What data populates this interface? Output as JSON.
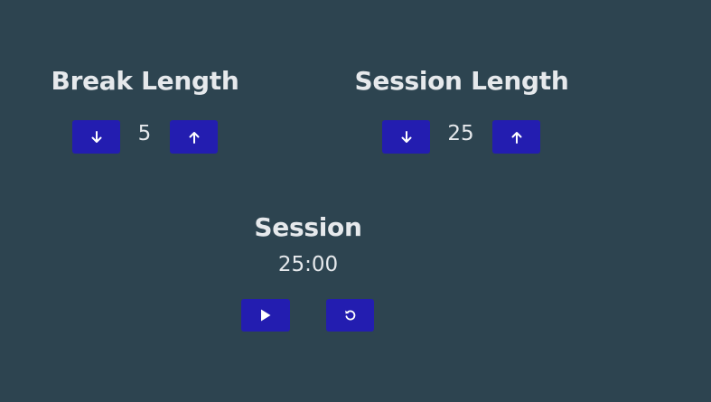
{
  "break": {
    "label": "Break Length",
    "value": "5",
    "decrement_icon": "arrow-down-icon",
    "increment_icon": "arrow-up-icon"
  },
  "session": {
    "label": "Session Length",
    "value": "25",
    "decrement_icon": "arrow-down-icon",
    "increment_icon": "arrow-up-icon"
  },
  "timer": {
    "label": "Session",
    "time": "25:00",
    "start_icon": "play-icon",
    "reset_icon": "reset-icon"
  },
  "colors": {
    "background": "#2d4450",
    "button": "#231db0",
    "text": "#e6e9ec"
  }
}
